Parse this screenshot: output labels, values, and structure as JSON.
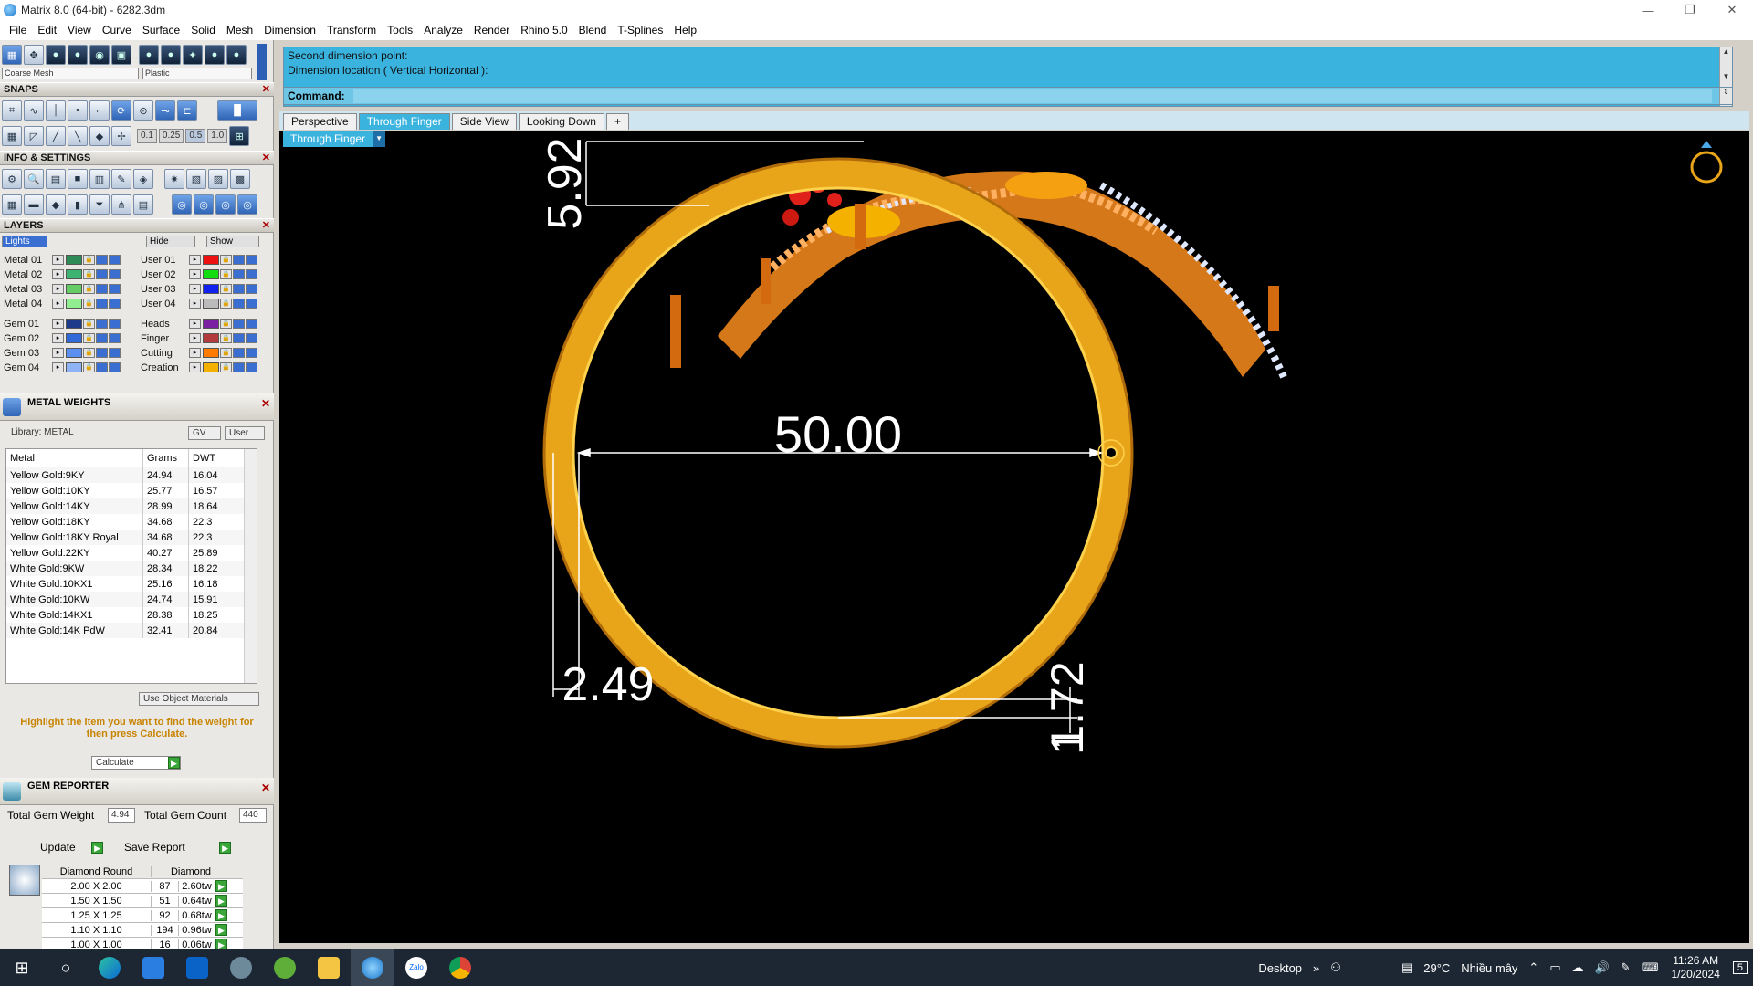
{
  "window": {
    "title": "Matrix 8.0 (64-bit) - 6282.3dm",
    "minimize": "—",
    "restore": "❐",
    "close": "✕"
  },
  "menu": [
    "File",
    "Edit",
    "View",
    "Curve",
    "Surface",
    "Solid",
    "Mesh",
    "Dimension",
    "Transform",
    "Tools",
    "Analyze",
    "Render",
    "Rhino 5.0",
    "Blend",
    "T-Splines",
    "Help"
  ],
  "toolbar": {
    "mesh_select": "Coarse Mesh",
    "material_select": "Plastic"
  },
  "snaps": {
    "title": "SNAPS",
    "values": [
      "0.1",
      "0.25",
      "0.5",
      "1.0"
    ]
  },
  "info": {
    "title": "INFO & SETTINGS"
  },
  "layers": {
    "title": "LAYERS",
    "lights": "Lights",
    "hide": "Hide",
    "show": "Show",
    "left": [
      {
        "name": "Metal 01",
        "color": "#2e8b57"
      },
      {
        "name": "Metal 02",
        "color": "#3cb371"
      },
      {
        "name": "Metal 03",
        "color": "#66cc66"
      },
      {
        "name": "Metal 04",
        "color": "#90ee90"
      },
      {
        "name": "Gem 01",
        "color": "#1e3a8a"
      },
      {
        "name": "Gem 02",
        "color": "#2f6ad8"
      },
      {
        "name": "Gem 03",
        "color": "#5b8ff0"
      },
      {
        "name": "Gem 04",
        "color": "#8fb4f5"
      }
    ],
    "right": [
      {
        "name": "User 01",
        "color": "#ee1111"
      },
      {
        "name": "User 02",
        "color": "#11dd11"
      },
      {
        "name": "User 03",
        "color": "#1122ee"
      },
      {
        "name": "User 04",
        "color": "#bbbbbb"
      },
      {
        "name": "Heads",
        "color": "#7a1fa2"
      },
      {
        "name": "Finger",
        "color": "#b23a3a"
      },
      {
        "name": "Cutting",
        "color": "#ff7a00"
      },
      {
        "name": "Creation",
        "color": "#f5b100"
      }
    ]
  },
  "metal_weights": {
    "title": "METAL WEIGHTS",
    "library": "Library: METAL",
    "gv": "GV",
    "user": "User",
    "headers": {
      "metal": "Metal",
      "grams": "Grams",
      "dwt": "DWT"
    },
    "rows": [
      {
        "metal": "Yellow Gold:9KY",
        "grams": "24.94",
        "dwt": "16.04"
      },
      {
        "metal": "Yellow Gold:10KY",
        "grams": "25.77",
        "dwt": "16.57"
      },
      {
        "metal": "Yellow Gold:14KY",
        "grams": "28.99",
        "dwt": "18.64"
      },
      {
        "metal": "Yellow Gold:18KY",
        "grams": "34.68",
        "dwt": "22.3"
      },
      {
        "metal": "Yellow Gold:18KY Royal",
        "grams": "34.68",
        "dwt": "22.3"
      },
      {
        "metal": "Yellow Gold:22KY",
        "grams": "40.27",
        "dwt": "25.89"
      },
      {
        "metal": "White Gold:9KW",
        "grams": "28.34",
        "dwt": "18.22"
      },
      {
        "metal": "White Gold:10KX1",
        "grams": "25.16",
        "dwt": "16.18"
      },
      {
        "metal": "White Gold:10KW",
        "grams": "24.74",
        "dwt": "15.91"
      },
      {
        "metal": "White Gold:14KX1",
        "grams": "28.38",
        "dwt": "18.25"
      },
      {
        "metal": "White Gold:14K PdW",
        "grams": "32.41",
        "dwt": "20.84"
      }
    ],
    "use_object_materials": "Use Object Materials",
    "hint": "Highlight the item you want to find the weight for then press Calculate.",
    "calculate": "Calculate"
  },
  "gem_reporter": {
    "title": "GEM REPORTER",
    "total_weight_label": "Total Gem Weight",
    "total_weight": "4.94",
    "total_count_label": "Total Gem Count",
    "total_count": "440",
    "update": "Update",
    "save_report": "Save Report",
    "headers": {
      "shape": "Diamond Round",
      "type": "Diamond"
    },
    "rows": [
      {
        "size": "2.00 X 2.00",
        "count": "87",
        "weight": "2.60tw"
      },
      {
        "size": "1.50 X 1.50",
        "count": "51",
        "weight": "0.64tw"
      },
      {
        "size": "1.25 X 1.25",
        "count": "92",
        "weight": "0.68tw"
      },
      {
        "size": "1.10 X 1.10",
        "count": "194",
        "weight": "0.96tw"
      },
      {
        "size": "1.00 X 1.00",
        "count": "16",
        "weight": "0.06tw"
      }
    ]
  },
  "command": {
    "history": [
      "Second dimension point:",
      "Dimension location ( Vertical  Horizontal ):"
    ],
    "label": "Command:",
    "value": ""
  },
  "tabs": [
    {
      "label": "Perspective",
      "active": false
    },
    {
      "label": "Through Finger",
      "active": true
    },
    {
      "label": "Side View",
      "active": false
    },
    {
      "label": "Looking Down",
      "active": false
    },
    {
      "label": "+",
      "active": false
    }
  ],
  "viewport": {
    "view_name": "Through Finger",
    "dimensions": [
      "5.92",
      "50.00",
      "2.49",
      "1.72",
      "1"
    ],
    "colors": {
      "gold": "#e8a51a",
      "gold_light": "#ffd24d",
      "background": "#000000",
      "dim": "#ffffff",
      "gem_red": "#e0201a",
      "gem_white": "#dfe8ff"
    }
  },
  "taskbar": {
    "desktop": "Desktop",
    "weather_temp": "29°C",
    "weather_desc": "Nhiều mây",
    "time": "11:26 AM",
    "date": "1/20/2024",
    "notif": "5"
  }
}
